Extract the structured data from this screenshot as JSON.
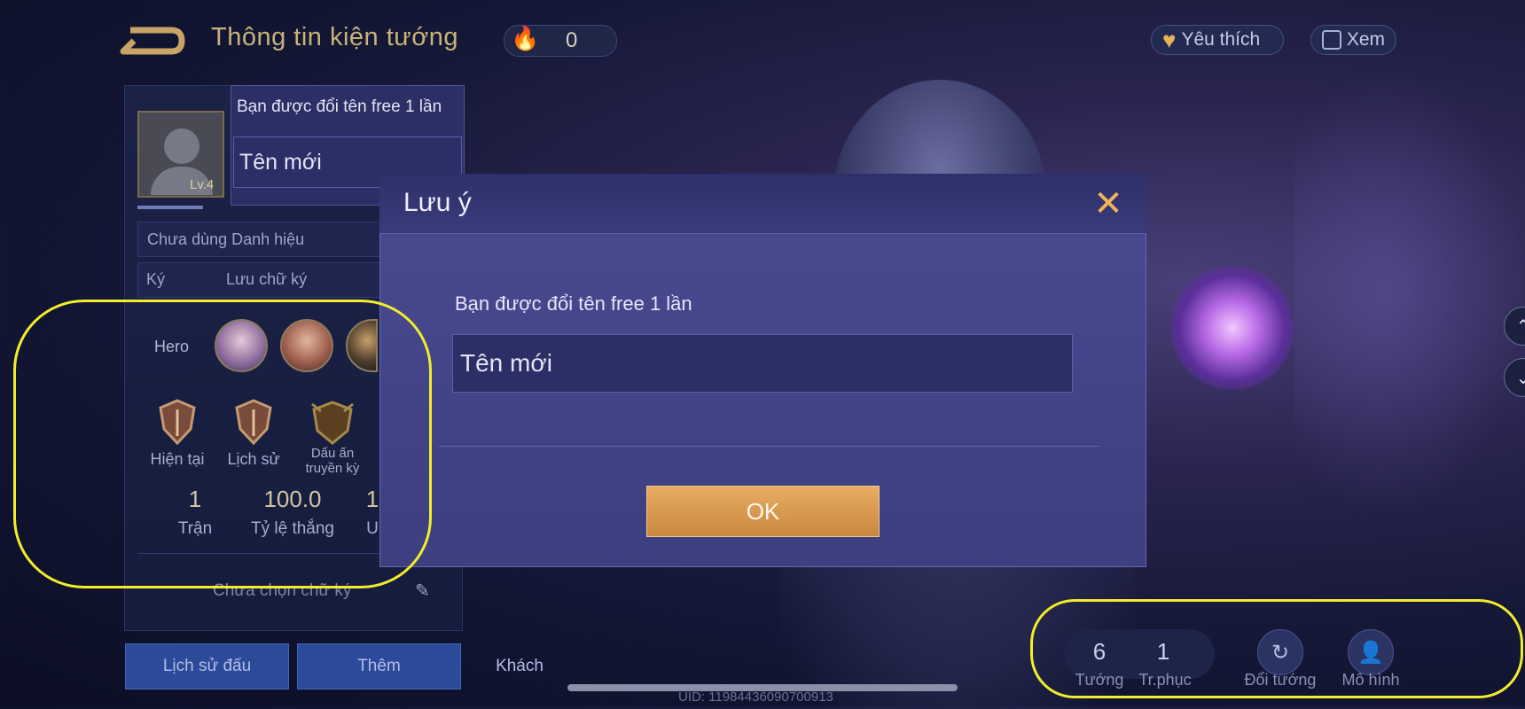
{
  "header": {
    "title": "Thông tin kiện tướng",
    "fire_value": "0",
    "favorite_label": "Yêu thích",
    "view_label": "Xem"
  },
  "profile": {
    "level": "Lv.4",
    "title_label": "Chưa dùng Danh hiệu",
    "sign_label_a": "Ký",
    "sign_label_b": "Lưu chữ ký",
    "hero_label": "Hero",
    "rank_labels": [
      "Hiện tại",
      "Lịch sử",
      "Dấu ấn",
      "truyền kỳ"
    ],
    "stats": [
      {
        "value": "1",
        "label": "Trận"
      },
      {
        "value": "100.0",
        "label": "Tỷ lệ thắng"
      },
      {
        "value": "1",
        "label": "U"
      }
    ],
    "signature_placeholder": "Chưa chọn chữ ký"
  },
  "bottom_tabs": [
    "Lịch sử đấu",
    "Thêm",
    "Khách"
  ],
  "uid": "UID: 11984436090700913",
  "collection": {
    "heroes_value": "6",
    "heroes_label": "Tướng",
    "skins_value": "1",
    "skins_label": "Tr.phục",
    "change_hero_label": "Đổi tướng",
    "model_label": "Mô hình"
  },
  "rename_popup": {
    "hint": "Bạn được đổi tên free 1 lần",
    "input_placeholder": "Tên mới"
  },
  "dialog": {
    "title": "Lưu ý",
    "hint": "Bạn được đổi tên free 1 lần",
    "input_placeholder": "Tên mới",
    "ok_label": "OK"
  },
  "colors": {
    "accent_gold": "#c9b27a",
    "ok_button": "#e8ad63",
    "annotation": "#f2ec2c"
  }
}
